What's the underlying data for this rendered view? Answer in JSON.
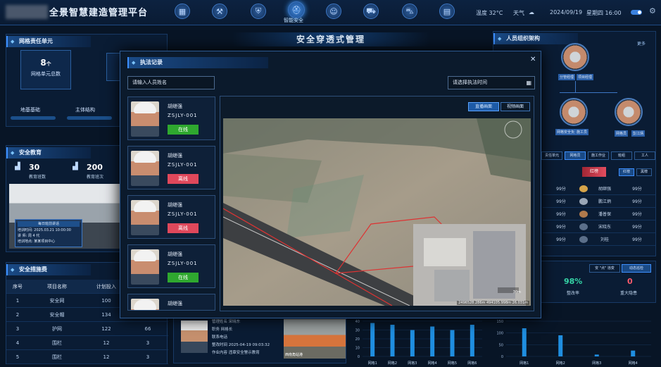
{
  "header": {
    "title": "全景智慧建造管理平台",
    "active_nav": "智能安全",
    "temperature": "温度 32°C",
    "weather": "天气",
    "date": "2024/09/19",
    "weekday_time": "星期四 16:00",
    "nav_icons": [
      "dashboard-icon",
      "tool-icon",
      "shield-icon",
      "safety-icon",
      "person-icon",
      "vehicle-icon",
      "cart-icon",
      "document-icon"
    ]
  },
  "left": {
    "grid_title": "网格责任单元",
    "grid_count": "8",
    "grid_count_unit": "个",
    "grid_count_label": "网格单元总数",
    "tabs": [
      "地基基础",
      "主体结构"
    ],
    "education_title": "安全教育",
    "edu_stat1_value": "30",
    "edu_stat1_label": "教育班数",
    "edu_stat2_value": "200",
    "edu_stat2_label": "教育班次",
    "training_card_title": "每日班前讲话",
    "training_time": "培训时间: 2025.03.21 10:00:00",
    "training_teacher": "讲    师: 周 4 代",
    "training_place": "培训地点: 某某项目中心",
    "measures_title": "安全措施费",
    "table_headers": [
      "序号",
      "项目名称",
      "计划投入",
      ""
    ],
    "table_rows": [
      [
        "1",
        "安全网",
        "100",
        ""
      ],
      [
        "2",
        "安全帽",
        "134",
        ""
      ],
      [
        "3",
        "护网",
        "122",
        "66"
      ],
      [
        "4",
        "围栏",
        "12",
        "3"
      ],
      [
        "5",
        "围栏",
        "12",
        "3"
      ]
    ]
  },
  "center_title": "安全穿透式管理",
  "modal": {
    "title": "执法记录",
    "name_placeholder": "请输入人员姓名",
    "time_placeholder": "请选择执法时间",
    "live_btn": "直播画面",
    "replay_btn": "视频画面",
    "photo_caption": "2496528.286m 494105.998m 26.031m",
    "scale_label": "30m",
    "persons": [
      {
        "name": "胡继强",
        "id": "ZSJLY-001",
        "status": "在线",
        "online": true
      },
      {
        "name": "胡继强",
        "id": "ZSJLY-001",
        "status": "离线",
        "online": false
      },
      {
        "name": "胡继强",
        "id": "ZSJLY-001",
        "status": "离线",
        "online": false
      },
      {
        "name": "胡继强",
        "id": "ZSJLY-001",
        "status": "在线",
        "online": true
      },
      {
        "name": "胡继强",
        "id": "",
        "status": "",
        "online": true
      }
    ]
  },
  "bottom": {
    "person_fields": [
      "管理姓名  宋晓东",
      "职务      网格长",
      "联系电话",
      "整改时间  2025-04-19 09:03:32",
      "作业内容  违章安全警示教育"
    ],
    "photo_label": "西南角站港",
    "chart1": {
      "y_ticks": [
        "40",
        "30",
        "20",
        "10",
        "0"
      ],
      "categories": [
        "网格1",
        "网格2",
        "网格3",
        "网格4",
        "网格5",
        "网格6"
      ]
    },
    "chart2": {
      "y_ticks": [
        "150",
        "100",
        "50",
        "0"
      ],
      "categories": [
        "网格1",
        "网格2",
        "网格3",
        "网格4"
      ]
    }
  },
  "right": {
    "org_title": "人员组织架构",
    "more": "更多",
    "org_labels": [
      "分管经理",
      "项目经理",
      "网格安全负责人",
      "网格员",
      "施工员",
      "彭江炳"
    ],
    "tabs": [
      "责任单元",
      "网格员",
      "施工作业",
      "班组",
      "工人"
    ],
    "filter_tabs": [
      "红榜",
      "黑榜"
    ],
    "red_list": "红榜",
    "rank_rows": [
      [
        "99分",
        "胡继强",
        "99分"
      ],
      [
        "99分",
        "鹏江炳",
        "99分"
      ],
      [
        "99分",
        "潘普保",
        "99分"
      ],
      [
        "99分",
        "宋晓东",
        "99分"
      ],
      [
        "99分",
        "刘桂",
        "99分"
      ]
    ],
    "rectify_tabs": [
      "安 \"点\" 违变",
      "动态巡检"
    ],
    "rectify_rate": "98%",
    "rectify_rate_label": "整改率",
    "major_hazard": "0",
    "major_hazard_label": "重大隐患"
  },
  "chart_data": [
    {
      "type": "bar",
      "categories": [
        "网格1",
        "网格2",
        "网格3",
        "网格4",
        "网格5",
        "网格6"
      ],
      "values": [
        38,
        36,
        30,
        34,
        30,
        36
      ],
      "ylim": [
        0,
        40
      ]
    },
    {
      "type": "bar",
      "categories": [
        "网格1",
        "网格2",
        "网格3",
        "网格4"
      ],
      "values": [
        120,
        90,
        8,
        25
      ],
      "ylim": [
        0,
        150
      ]
    }
  ]
}
